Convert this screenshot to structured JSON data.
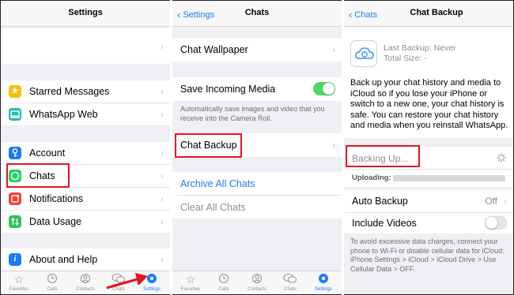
{
  "screen1": {
    "title": "Settings",
    "items": [
      {
        "label": "Starred Messages",
        "icon": "star-icon",
        "color": "#f4c20d"
      },
      {
        "label": "WhatsApp Web",
        "icon": "laptop-icon",
        "color": "#1ebea5"
      },
      {
        "label": "Account",
        "icon": "key-icon",
        "color": "#1a7cf5"
      },
      {
        "label": "Chats",
        "icon": "whatsapp-icon",
        "color": "#25d366"
      },
      {
        "label": "Notifications",
        "icon": "notification-icon",
        "color": "#ff3b30"
      },
      {
        "label": "Data Usage",
        "icon": "data-usage-icon",
        "color": "#2bc25b"
      },
      {
        "label": "About and Help",
        "icon": "info-icon",
        "color": "#1a7cf5"
      }
    ],
    "tabs": [
      "Favorites",
      "Calls",
      "Contacts",
      "Chats",
      "Settings"
    ],
    "active_tab": "Settings"
  },
  "screen2": {
    "back": "Settings",
    "title": "Chats",
    "chat_wallpaper": "Chat Wallpaper",
    "save_media": "Save Incoming Media",
    "save_media_on": true,
    "save_media_note": "Automatically save images and video that you receive into the Camera Roll.",
    "chat_backup": "Chat Backup",
    "archive_all": "Archive All Chats",
    "clear_all": "Clear All Chats",
    "tabs": [
      "Favorites",
      "Calls",
      "Contacts",
      "Chats",
      "Settings"
    ],
    "active_tab": "Settings"
  },
  "screen3": {
    "back": "Chats",
    "title": "Chat Backup",
    "last_backup": "Last Backup: Never",
    "total_size": "Total Size: -",
    "description": "Back up your chat history and media to iCloud so if you lose your iPhone or switch to a new one, your chat history is safe. You can restore your chat history and media when you reinstall WhatsApp.",
    "backing_up": "Backing Up...",
    "uploading_label": "Uploading:",
    "auto_backup": "Auto Backup",
    "auto_backup_value": "Off",
    "include_videos": "Include Videos",
    "include_videos_on": false,
    "footer_note": "To avoid excessive data charges, connect your phone to Wi-Fi or disable cellular data for iCloud: iPhone Settings > iCloud > iCloud Drive > Use Cellular Data > OFF."
  },
  "colors": {
    "accent": "#1a7cf5",
    "highlight": "#e8131f",
    "toggle_on": "#4cd964",
    "background": "#efeff4"
  }
}
